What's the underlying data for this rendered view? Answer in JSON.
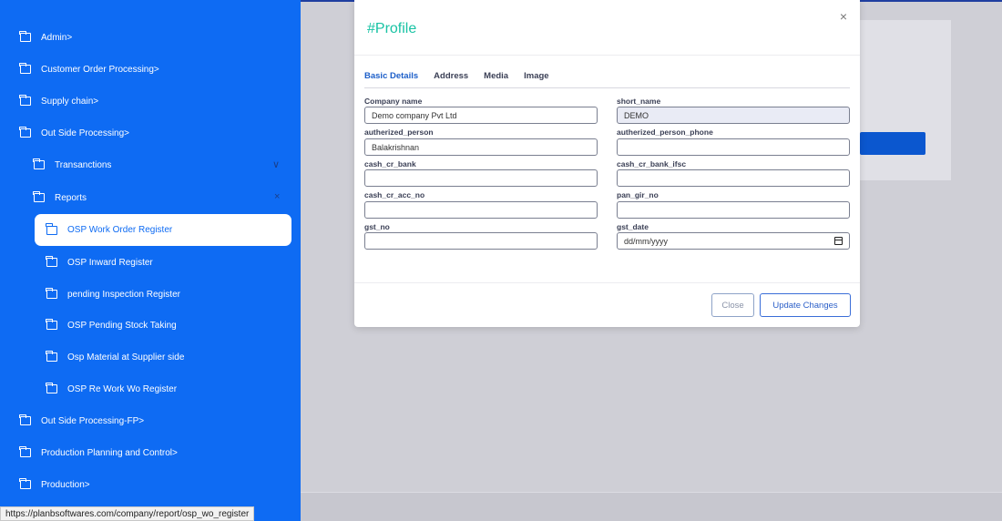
{
  "sidebar": {
    "items": [
      {
        "label": "Admin>"
      },
      {
        "label": "Customer Order Processing>"
      },
      {
        "label": "Supply chain>"
      },
      {
        "label": "Out Side Processing>"
      },
      {
        "label": "Transanctions"
      },
      {
        "label": "Reports"
      },
      {
        "label": "OSP Work Order Register"
      },
      {
        "label": "OSP Inward Register"
      },
      {
        "label": "pending Inspection Register"
      },
      {
        "label": "OSP Pending Stock Taking"
      },
      {
        "label": "Osp Material at Supplier side"
      },
      {
        "label": "OSP Re Work Wo Register"
      },
      {
        "label": "Out Side Processing-FP>"
      },
      {
        "label": "Production Planning and Control>"
      },
      {
        "label": "Production>"
      }
    ],
    "transactions_chevron": "∨",
    "reports_close": "×"
  },
  "modal": {
    "title": "#Profile",
    "close_icon": "×",
    "tabs": [
      {
        "label": "Basic Details"
      },
      {
        "label": "Address"
      },
      {
        "label": "Media"
      },
      {
        "label": "Image"
      }
    ],
    "fields": {
      "company_name": {
        "label": "Company name",
        "value": "Demo company Pvt Ltd"
      },
      "short_name": {
        "label": "short_name",
        "value": "DEMO"
      },
      "autherized_person": {
        "label": "autherized_person",
        "value": "Balakrishnan"
      },
      "autherized_person_phone": {
        "label": "autherized_person_phone",
        "value": ""
      },
      "cash_cr_bank": {
        "label": "cash_cr_bank",
        "value": ""
      },
      "cash_cr_bank_ifsc": {
        "label": "cash_cr_bank_ifsc",
        "value": ""
      },
      "cash_cr_acc_no": {
        "label": "cash_cr_acc_no",
        "value": ""
      },
      "pan_gir_no": {
        "label": "pan_gir_no",
        "value": ""
      },
      "gst_no": {
        "label": "gst_no",
        "value": ""
      },
      "gst_date": {
        "label": "gst_date",
        "value": "dd/mm/yyyy"
      }
    },
    "buttons": {
      "close": "Close",
      "update": "Update Changes"
    }
  },
  "status": {
    "url": "https://planbsoftwares.com/company/report/osp_wo_register"
  },
  "colors": {
    "sidebar": "#0e6bf3",
    "title": "#19c3a4",
    "accent": "#1d5fc9"
  }
}
